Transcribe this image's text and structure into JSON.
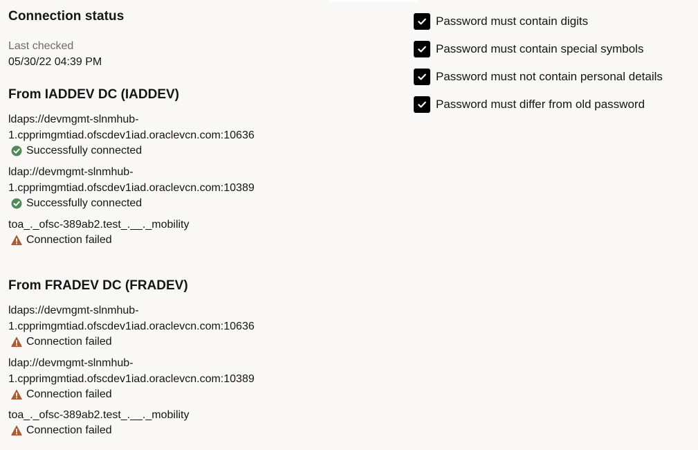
{
  "connection_status": {
    "title": "Connection status",
    "last_checked_label": "Last checked",
    "last_checked_value": "05/30/22 04:39 PM"
  },
  "dcs": [
    {
      "heading": "From IADDEV DC (IADDEV)",
      "connections": [
        {
          "url_line1": "ldaps://devmgmt-slnmhub-",
          "url_line2": "1.cpprimgmtiad.ofscdev1iad.oraclevcn.com:10636",
          "status": "Successfully connected",
          "status_type": "success"
        },
        {
          "url_line1": "ldap://devmgmt-slnmhub-",
          "url_line2": "1.cpprimgmtiad.ofscdev1iad.oraclevcn.com:10389",
          "status": "Successfully connected",
          "status_type": "success"
        },
        {
          "url_line1": "toa_._ofsc-389ab2.test_.__._mobility",
          "url_line2": "",
          "status": "Connection failed",
          "status_type": "warning"
        }
      ]
    },
    {
      "heading": "From FRADEV DC (FRADEV)",
      "connections": [
        {
          "url_line1": "ldaps://devmgmt-slnmhub-",
          "url_line2": "1.cpprimgmtiad.ofscdev1iad.oraclevcn.com:10636",
          "status": "Connection failed",
          "status_type": "warning"
        },
        {
          "url_line1": "ldap://devmgmt-slnmhub-",
          "url_line2": "1.cpprimgmtiad.ofscdev1iad.oraclevcn.com:10389",
          "status": "Connection failed",
          "status_type": "warning"
        },
        {
          "url_line1": "toa_._ofsc-389ab2.test_.__._mobility",
          "url_line2": "",
          "status": "Connection failed",
          "status_type": "warning"
        }
      ]
    }
  ],
  "password_rules": [
    {
      "label": "Password must contain digits",
      "checked": true
    },
    {
      "label": "Password must contain special symbols",
      "checked": true
    },
    {
      "label": "Password must not contain personal details",
      "checked": true
    },
    {
      "label": "Password must differ from old password",
      "checked": true
    }
  ],
  "colors": {
    "success": "#508a5a",
    "warning": "#a85d34",
    "checkbox": "#000000"
  },
  "icons": {
    "success": "check-circle-icon",
    "warning": "warning-triangle-icon",
    "checkbox": "checkmark-icon"
  }
}
